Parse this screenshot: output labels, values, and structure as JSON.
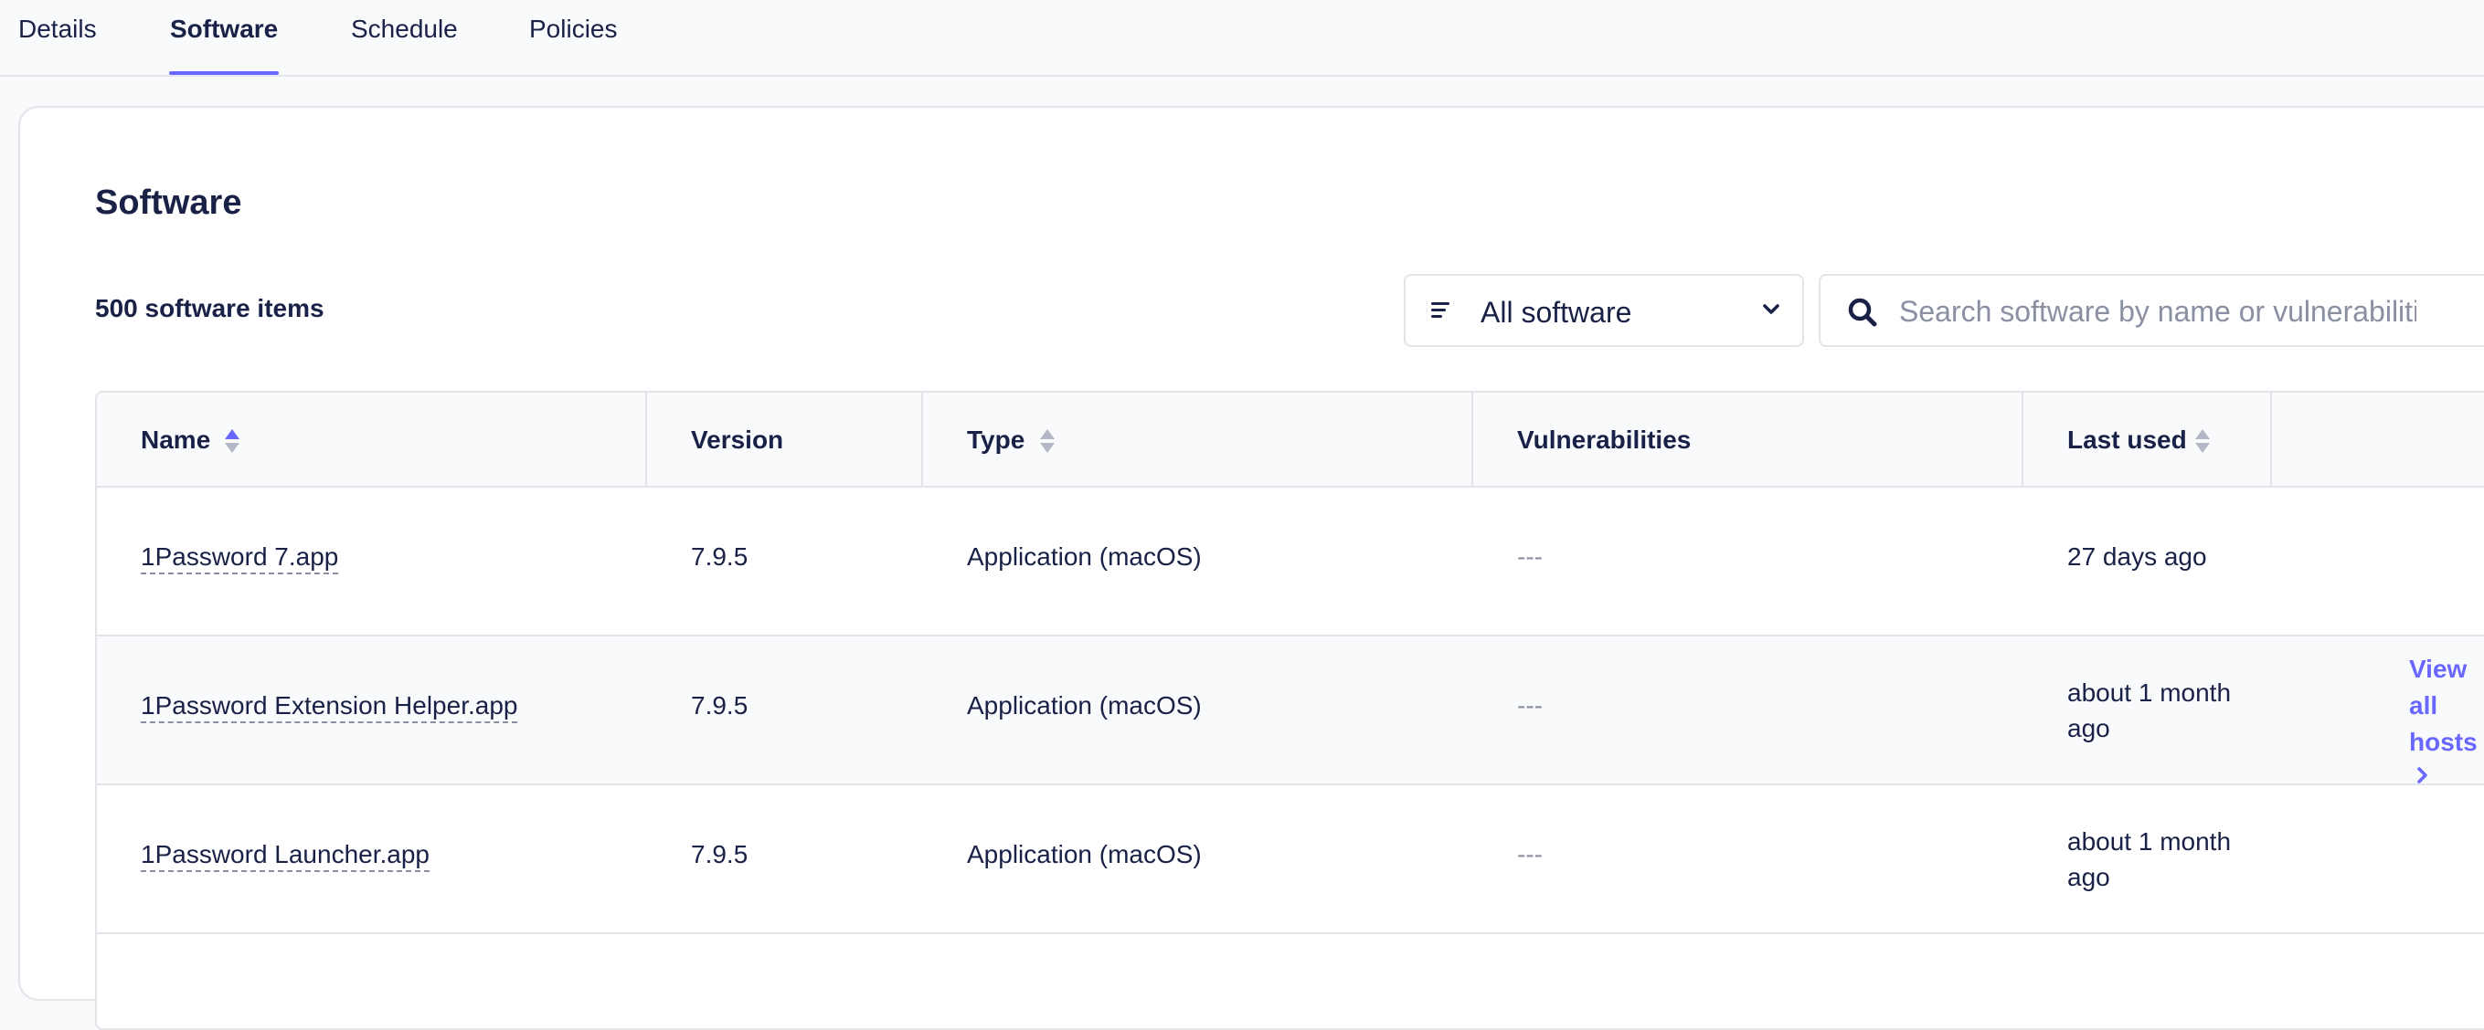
{
  "tabs": [
    {
      "label": "Details",
      "active": false
    },
    {
      "label": "Software",
      "active": true
    },
    {
      "label": "Schedule",
      "active": false
    },
    {
      "label": "Policies",
      "active": false
    }
  ],
  "card": {
    "title": "Software",
    "count_label": "500 software items"
  },
  "filter": {
    "selected": "All software",
    "icon": "filter-lines-icon"
  },
  "search": {
    "placeholder": "Search software by name or vulnerabilities",
    "icon": "search-icon"
  },
  "table": {
    "columns": [
      {
        "label": "Name",
        "sortable": true,
        "sorted": true
      },
      {
        "label": "Version",
        "sortable": false
      },
      {
        "label": "Type",
        "sortable": true
      },
      {
        "label": "Vulnerabilities",
        "sortable": false
      },
      {
        "label": "Last used",
        "sortable": true
      },
      {
        "label": "",
        "sortable": false
      }
    ],
    "rows": [
      {
        "name": "1Password 7.app",
        "version": "7.9.5",
        "type": "Application (macOS)",
        "vulnerabilities": "---",
        "last_used": "27 days ago",
        "hovered": false
      },
      {
        "name": "1Password Extension Helper.app",
        "version": "7.9.5",
        "type": "Application (macOS)",
        "vulnerabilities": "---",
        "last_used": "about 1 month ago",
        "hovered": true,
        "action_label": "View all hosts"
      },
      {
        "name": "1Password Launcher.app",
        "version": "7.9.5",
        "type": "Application (macOS)",
        "vulnerabilities": "---",
        "last_used": "about 1 month ago",
        "hovered": false
      }
    ]
  },
  "colors": {
    "accent": "#6a67fe",
    "text": "#192147",
    "muted": "#8b8fa2",
    "border": "#e2e4ea",
    "surface": "#f9fafc"
  }
}
